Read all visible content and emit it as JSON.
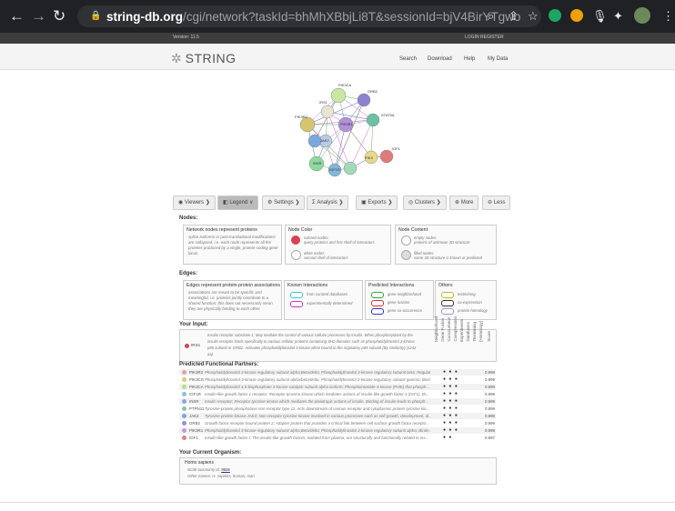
{
  "browser": {
    "url_host": "string-db.org",
    "url_path": "/cgi/network?taskId=bhMhXBbjLi8T&sessionId=bjV4BirYTgwo"
  },
  "site": {
    "version": "Version: 11.5",
    "login": "LOGIN",
    "register": "REGISTER",
    "logo": "STRING",
    "nav": [
      "Search",
      "Download",
      "Help",
      "My Data"
    ]
  },
  "network_nodes": [
    "PIK3CA",
    "GRB2",
    "IRS1",
    "PIK3R2",
    "STAT5A",
    "PIK3R1",
    "IGF1",
    "JAK2",
    "PIK3",
    "INSR",
    "IGF1R"
  ],
  "menu": [
    {
      "label": "Viewers ❯",
      "icon": "eye-icon"
    },
    {
      "label": "Legend ∨",
      "icon": "legend-icon"
    },
    {
      "label": "Settings ❯",
      "icon": "gear-icon"
    },
    {
      "label": "Analysis ❯",
      "icon": "sigma-icon"
    },
    {
      "label": "Exports ❯",
      "icon": "export-icon"
    },
    {
      "label": "Clusters ❯",
      "icon": "cluster-icon"
    },
    {
      "label": "More",
      "icon": "plus-icon"
    },
    {
      "label": "Less",
      "icon": "minus-icon"
    }
  ],
  "nodes_section": {
    "heading": "Nodes:",
    "box1_title": "Network nodes represent proteins",
    "box1_lines": [
      "splice isoforms or post-translational modifications",
      "are collapsed, i.e. each node represents all the",
      "proteins produced by a single, protein-coding gene",
      "locus."
    ],
    "box2_title": "Node Color",
    "color_a": [
      "colored nodes:",
      "query proteins and first shell of interactors"
    ],
    "color_b": [
      "white nodes:",
      "second shell of interactors"
    ],
    "box3_title": "Node Content",
    "content_a": [
      "empty nodes:",
      "proteins of unknown 3D structure"
    ],
    "content_b": [
      "filled nodes:",
      "some 3D structure is known or predicted"
    ]
  },
  "edges_section": {
    "heading": "Edges:",
    "box1_title": "Edges represent protein-protein associations",
    "box1_lines": [
      "associations are meant to be specific and",
      "meaningful, i.e. proteins jointly contribute to a",
      "shared function; this does not necessarily mean",
      "they are physically binding to each other."
    ],
    "known_title": "Known Interactions",
    "known": [
      "from curated databases",
      "experimentally determined"
    ],
    "predicted_title": "Predicted Interactions",
    "predicted": [
      "gene neighborhood",
      "gene fusions",
      "gene co-occurrence"
    ],
    "others_title": "Others",
    "others": [
      "textmining",
      "co-expression",
      "protein homology"
    ]
  },
  "input": {
    "heading": "Your Input:",
    "name": "IRS1",
    "lines": [
      "Insulin receptor substrate 1; May mediate the control of various cellular processes by insulin. When phosphorylated by the",
      "insulin receptor binds specifically to various cellular proteins containing SH2 domains such as phosphatidylinositol 3-kinase",
      "p85 subunit or GRB2. Activates phosphatidylinositol 3-kinase when bound to the regulatory p85 subunit (By similarity) (1242",
      "aa)"
    ]
  },
  "evidence_labels": [
    "Neighborhood",
    "Gene Fusion",
    "Cooccurence",
    "Coexpression",
    "Experiments",
    "Databases",
    "Textmining",
    "[Homology]",
    "Score"
  ],
  "partners": {
    "heading": "Predicted Functional Partners:",
    "rows": [
      {
        "name": "PIK3R2",
        "color": "#e8a0a0",
        "desc": "Phosphatidylinositol 3-kinase regulatory subunit alpha;Beta/delta; Phosphatidylinositol 3-kinase regulatory subunit beta; Regulat...",
        "ev": "● ● ●",
        "score": "0.999"
      },
      {
        "name": "PIK3CG",
        "color": "#d9c77b",
        "desc": "Phosphatidylinositol-3-kinase regulatory subunit alpha/beta/delta; Phosphatidylinositol 3-kinase regulatory subunit gamma; Bind...",
        "ev": "● ● ●",
        "score": "0.999"
      },
      {
        "name": "PIK3CA",
        "color": "#b9dc8a",
        "desc": "Phosphatidylinositol 4,5-bisphosphate 3-kinase catalytic subunit alpha isoform; Phosphoinositide-3-kinase (PI3K) that phosph...",
        "ev": "● ● ●",
        "score": "0.999"
      },
      {
        "name": "IGF1R",
        "color": "#8bc2d9",
        "desc": "Insulin-like growth factor 1 receptor; Receptor tyrosine kinase which mediates actions of insulin-like growth factor 1 (IGF1). Bi...",
        "ev": "● ● ●",
        "score": "0.999"
      },
      {
        "name": "INSR",
        "color": "#8ea8d9",
        "desc": "Insulin receptor; Receptor tyrosine kinase which mediates the pleiotropic actions of insulin. Binding of insulin leads to phosph...",
        "ev": "● ● ●",
        "score": "0.999"
      },
      {
        "name": "PTPN11",
        "color": "#7fc7a6",
        "desc": "Tyrosine-protein phosphatase non-receptor type 11; Acts downstream of various receptor and cytoplasmic protein tyrosine kin...",
        "ev": "● ● ●",
        "score": "0.999"
      },
      {
        "name": "JAK2",
        "color": "#7fa6d9",
        "desc": "Tyrosine-protein kinase JAK2; Non-receptor tyrosine kinase involved in various processes such as cell growth, development, di...",
        "ev": "● ● ●",
        "score": "0.999"
      },
      {
        "name": "GRB2",
        "color": "#9a8fd1",
        "desc": "Growth factor receptor-bound protein 2; Adapter protein that provides a critical link between cell surface growth factor recepto...",
        "ev": "● ● ●",
        "score": "0.999"
      },
      {
        "name": "PIK3R1",
        "color": "#c79ad9",
        "desc": "Phosphatidylinositol 3-kinase regulatory subunit alpha;Beta/delta; Phosphatidylinositol 3-kinase regulatory subunit alpha; Binds t...",
        "ev": "● ● ●",
        "score": "0.999"
      },
      {
        "name": "IGF1",
        "color": "#e08080",
        "desc": "Insulin-like growth factor I; The insulin-like growth factors, isolated from plasma, are structurally and functionally related to ins...",
        "ev": "● ●",
        "score": "0.997"
      }
    ]
  },
  "organism": {
    "heading": "Your Current Organism:",
    "name": "Homo sapiens",
    "tax_prefix": "NCBI taxonomy Id: ",
    "tax_id": "9606",
    "other_names": "Other names: H. sapiens, human, man"
  }
}
